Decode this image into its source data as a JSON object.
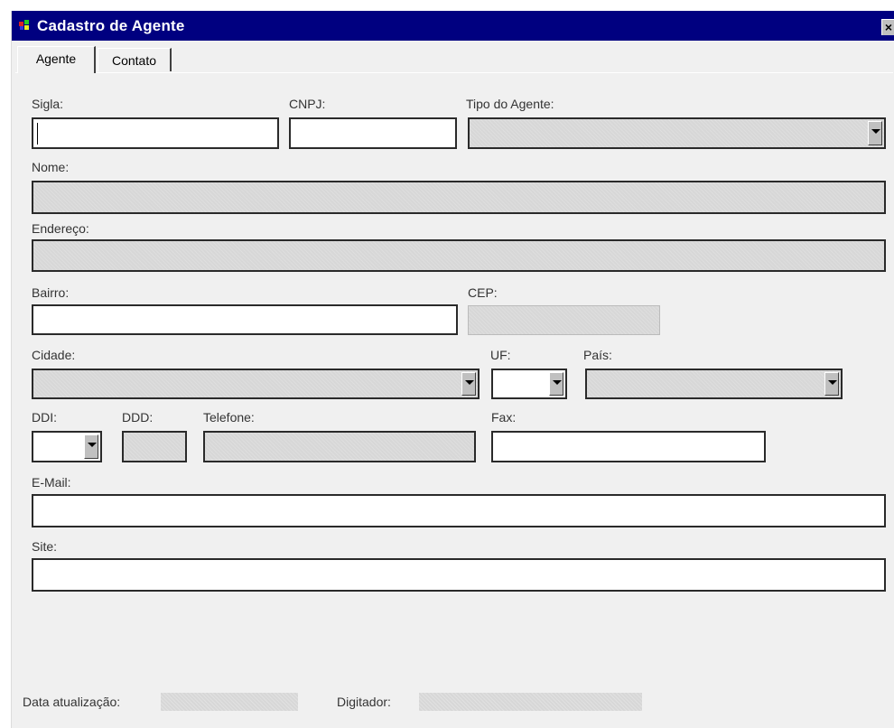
{
  "window": {
    "title": "Cadastro de Agente",
    "close_label": "×"
  },
  "tabs": [
    {
      "label": "Agente",
      "active": true
    },
    {
      "label": "Contato",
      "active": false
    }
  ],
  "form": {
    "sigla_label": "Sigla:",
    "cnpj_label": "CNPJ:",
    "tipo_label": "Tipo do Agente:",
    "nome_label": "Nome:",
    "endereco_label": "Endereço:",
    "bairro_label": "Bairro:",
    "cep_label": "CEP:",
    "cidade_label": "Cidade:",
    "uf_label": "UF:",
    "pais_label": "País:",
    "ddi_label": "DDI:",
    "ddd_label": "DDD:",
    "telefone_label": "Telefone:",
    "fax_label": "Fax:",
    "email_label": "E-Mail:",
    "site_label": "Site:",
    "sigla_value": "",
    "cnpj_value": "",
    "bairro_value": "",
    "fax_value": "",
    "email_value": "",
    "site_value": ""
  },
  "footer": {
    "data_label": "Data atualização:",
    "digitador_label": "Digitador:"
  },
  "colors": {
    "titlebar": "#000080",
    "disabled_field": "#d7d7d7",
    "panel": "#f0f0f0"
  },
  "icons": {
    "app": "app-icon",
    "close": "close-icon",
    "dropdown": "chevron-down-icon"
  }
}
